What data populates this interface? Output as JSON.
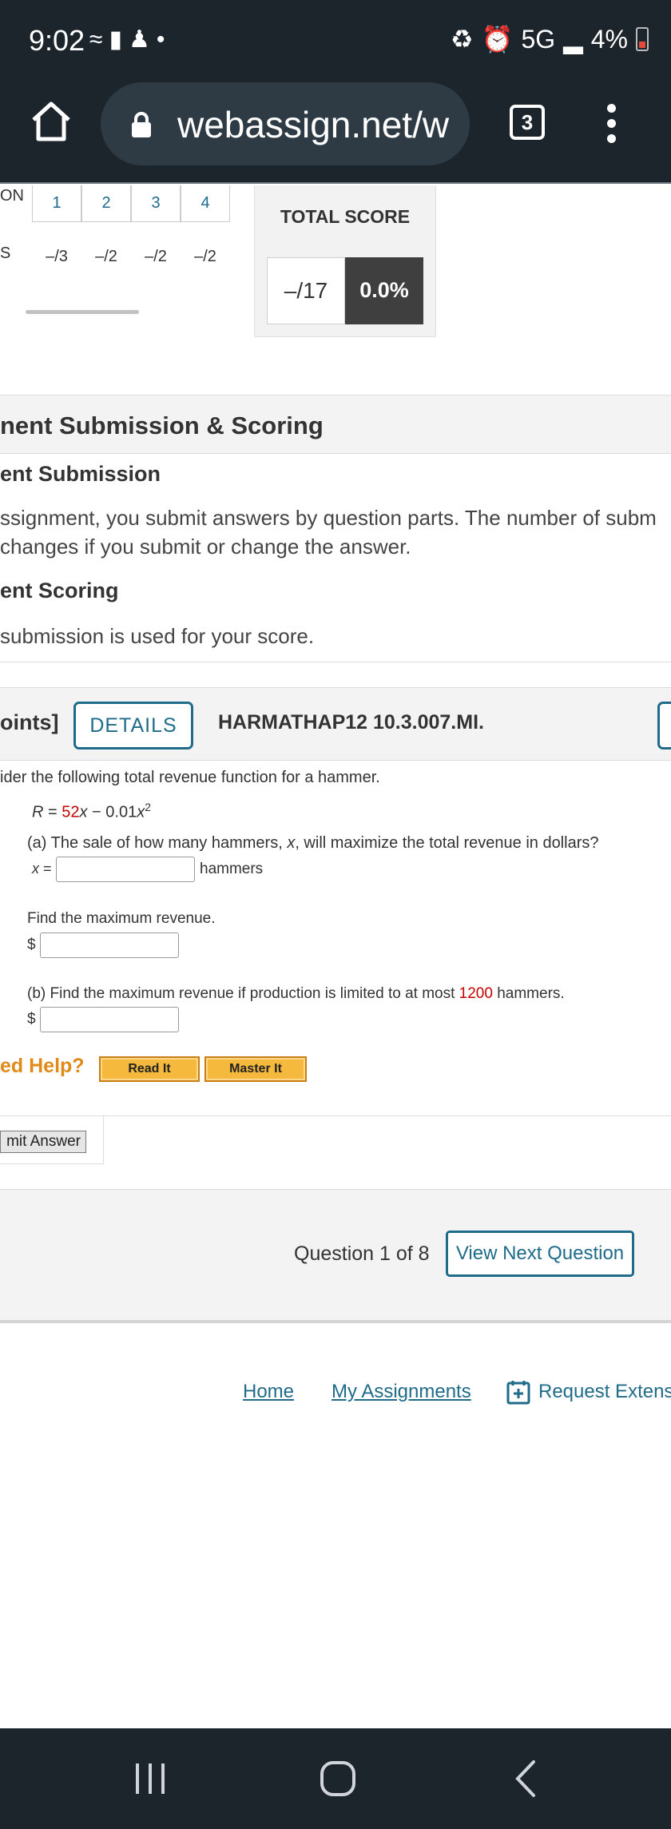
{
  "status_bar": {
    "time": "9:02",
    "left_icons": [
      "wifi-icon",
      "alert-icon",
      "accessibility-icon",
      "dot-icon"
    ],
    "network": "5G",
    "battery": "4%"
  },
  "browser": {
    "url": "webassign.net/w",
    "tab_count": "3"
  },
  "score_table": {
    "header_label": "ON",
    "score_label": "S",
    "questions": [
      {
        "num": "1",
        "score": "–/3"
      },
      {
        "num": "2",
        "score": "–/2"
      },
      {
        "num": "3",
        "score": "–/2"
      },
      {
        "num": "4",
        "score": "–/2"
      }
    ]
  },
  "total_score": {
    "title": "TOTAL SCORE",
    "raw": "–/17",
    "percent": "0.0%"
  },
  "submission": {
    "section_title": "nent Submission & Scoring",
    "submission_heading": "ent Submission",
    "submission_line1": "ssignment, you submit answers by question parts. The number of subm",
    "submission_line2": "changes if you submit or change the answer.",
    "scoring_heading": "ent Scoring",
    "scoring_text": "submission is used for your score."
  },
  "question": {
    "points_label": "oints]",
    "details_label": "DETAILS",
    "code": "HARMATHAP12 10.3.007.MI.",
    "intro": "ider the following total revenue function for a hammer.",
    "equation": {
      "R": "R",
      "eq": " = ",
      "coef": "52",
      "x1": "x",
      "rest": " − 0.01",
      "x2": "x",
      "exp": "2"
    },
    "part_a": {
      "prompt_prefix": "(a) The sale of how many hammers, ",
      "prompt_var": "x",
      "prompt_suffix": ", will maximize the total revenue in dollars?",
      "var_label": "x",
      "eq": " =",
      "unit": "hammers",
      "value": ""
    },
    "max_revenue": {
      "prompt": "Find the maximum revenue.",
      "currency": "$",
      "value": ""
    },
    "part_b": {
      "prompt_prefix": "(b) Find the maximum revenue if production is limited to at most ",
      "limit": "1200",
      "prompt_suffix": " hammers.",
      "currency": "$",
      "value": ""
    }
  },
  "help": {
    "label": "ed Help?",
    "read_it": "Read It",
    "master_it": "Master It"
  },
  "submit": {
    "label": "mit Answer"
  },
  "navigation": {
    "count": "Question 1 of 8",
    "next": "View Next Question"
  },
  "footer": {
    "home": "Home",
    "assignments": "My Assignments",
    "extension": "Request Extens"
  },
  "colors": {
    "link": "#1f6b8a",
    "emphasis_red": "#c40000",
    "help_orange": "#e08a1a",
    "chrome": "#1d252c"
  }
}
